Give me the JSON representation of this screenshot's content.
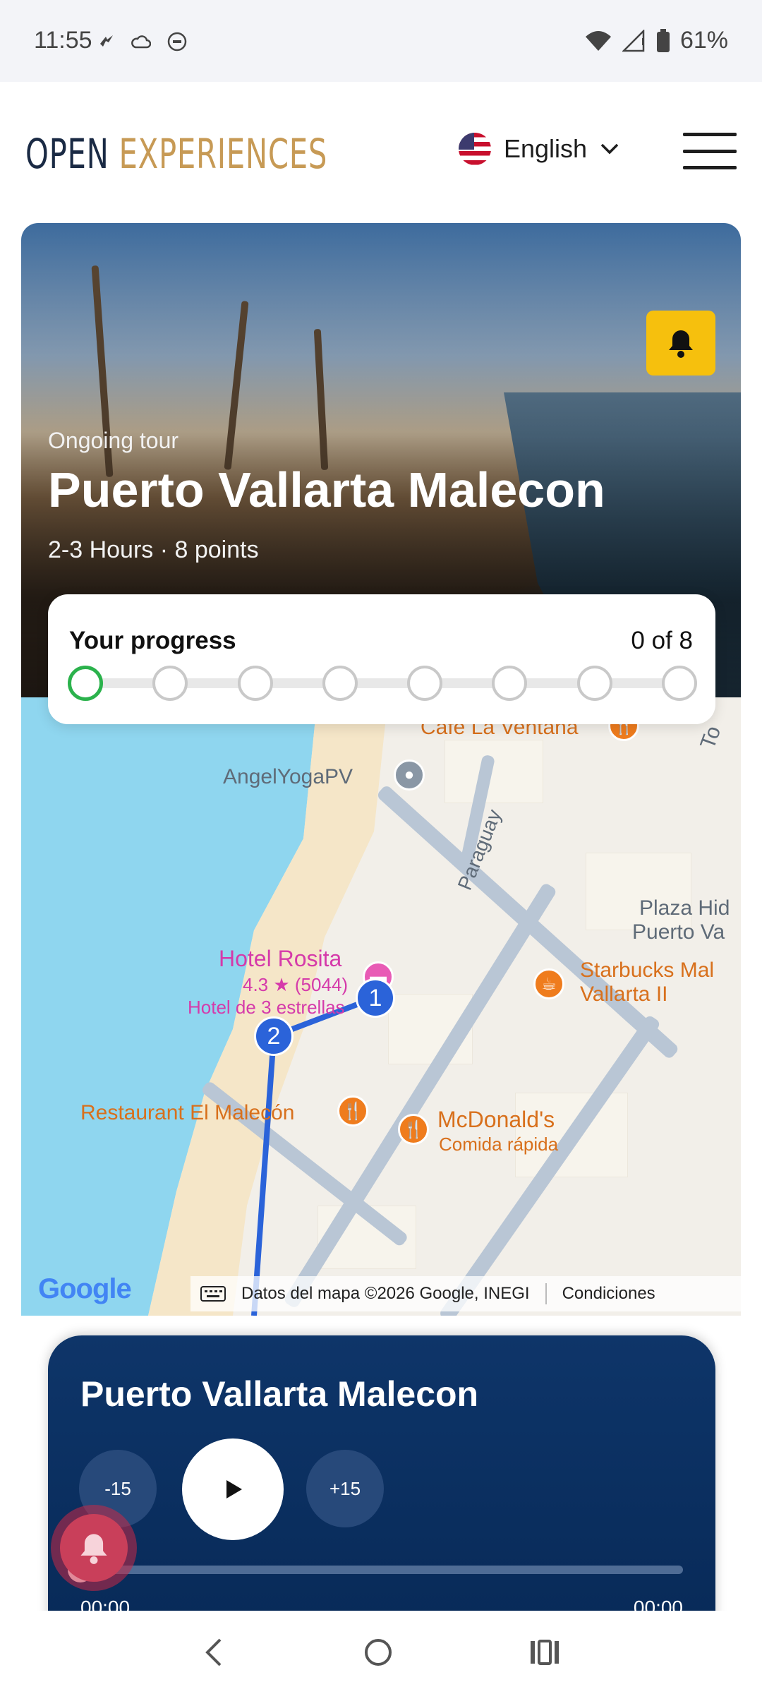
{
  "status_bar": {
    "time": "11:55",
    "battery": "61%"
  },
  "header": {
    "logo_open": "OPEN",
    "logo_experiences": "EXPERIENCES",
    "language": "English"
  },
  "hero": {
    "label": "Ongoing tour",
    "title": "Puerto Vallarta Malecon",
    "meta": "2-3 Hours · 8 points"
  },
  "progress": {
    "title": "Your progress",
    "count": "0 of 8",
    "completed": 0,
    "total": 8
  },
  "map": {
    "places": {
      "cafe": "Cafe La Ventana",
      "yoga": "AngelYogaPV",
      "street": "Paraguay",
      "plaza_line1": "Plaza Hid",
      "plaza_line2": "Puerto Va",
      "hotel_name": "Hotel Rosita",
      "hotel_rating": "4.3 ★ (5044)",
      "hotel_type": "Hotel de 3 estrellas",
      "starbucks_line1": "Starbucks Mal",
      "starbucks_line2": "Vallarta II",
      "restaurant": "Restaurant El Malecón",
      "mcdonalds": "McDonald's",
      "mcdonalds_type": "Comida rápida",
      "top_right": "To"
    },
    "markers": [
      "1",
      "2"
    ],
    "google": "Google",
    "attribution": "Datos del mapa ©2026 Google, INEGI",
    "terms": "Condiciones"
  },
  "player": {
    "title": "Puerto Vallarta Malecon",
    "back": "-15",
    "forward": "+15",
    "elapsed": "00:00",
    "duration": "00:00",
    "progress_fraction": 0
  },
  "colors": {
    "accent_gold": "#c79a55",
    "navy": "#0e3569",
    "progress_green": "#2bb24c",
    "alert_yellow": "#f6c00d"
  },
  "icons": {
    "bell": "bell-icon",
    "menu": "hamburger-menu-icon",
    "chevron": "chevron-down-icon",
    "play": "play-icon"
  }
}
